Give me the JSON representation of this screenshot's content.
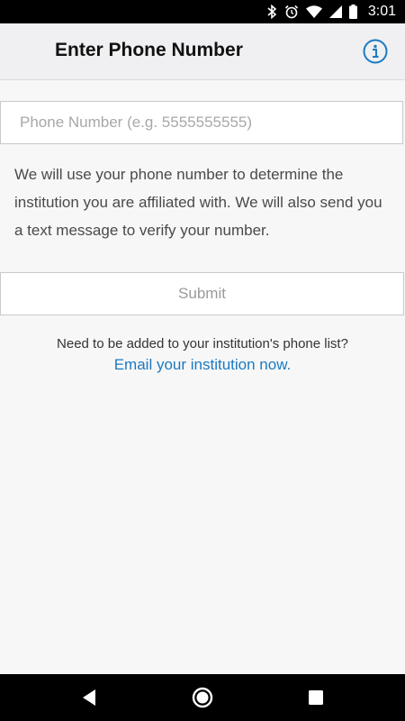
{
  "status_bar": {
    "time": "3:01",
    "icons": [
      "bluetooth-icon",
      "alarm-icon",
      "wifi-icon",
      "cell-signal-icon",
      "battery-icon"
    ]
  },
  "header": {
    "title": "Enter Phone Number",
    "info_icon": "info-icon"
  },
  "form": {
    "phone_placeholder": "Phone Number (e.g. 5555555555)",
    "phone_value": "",
    "description": "We will use your phone number to determine the institution you are affiliated with. We will also send you a text message to verify your number.",
    "submit_label": "Submit"
  },
  "help": {
    "prompt": "Need to be added to your institution's phone list?",
    "link_label": "Email your institution now."
  },
  "nav_bar": {
    "buttons": [
      "back-icon",
      "home-icon",
      "recents-icon"
    ]
  },
  "colors": {
    "accent": "#1b7ac2",
    "app_bar": "#f0f0f2",
    "background": "#f7f7f7"
  }
}
